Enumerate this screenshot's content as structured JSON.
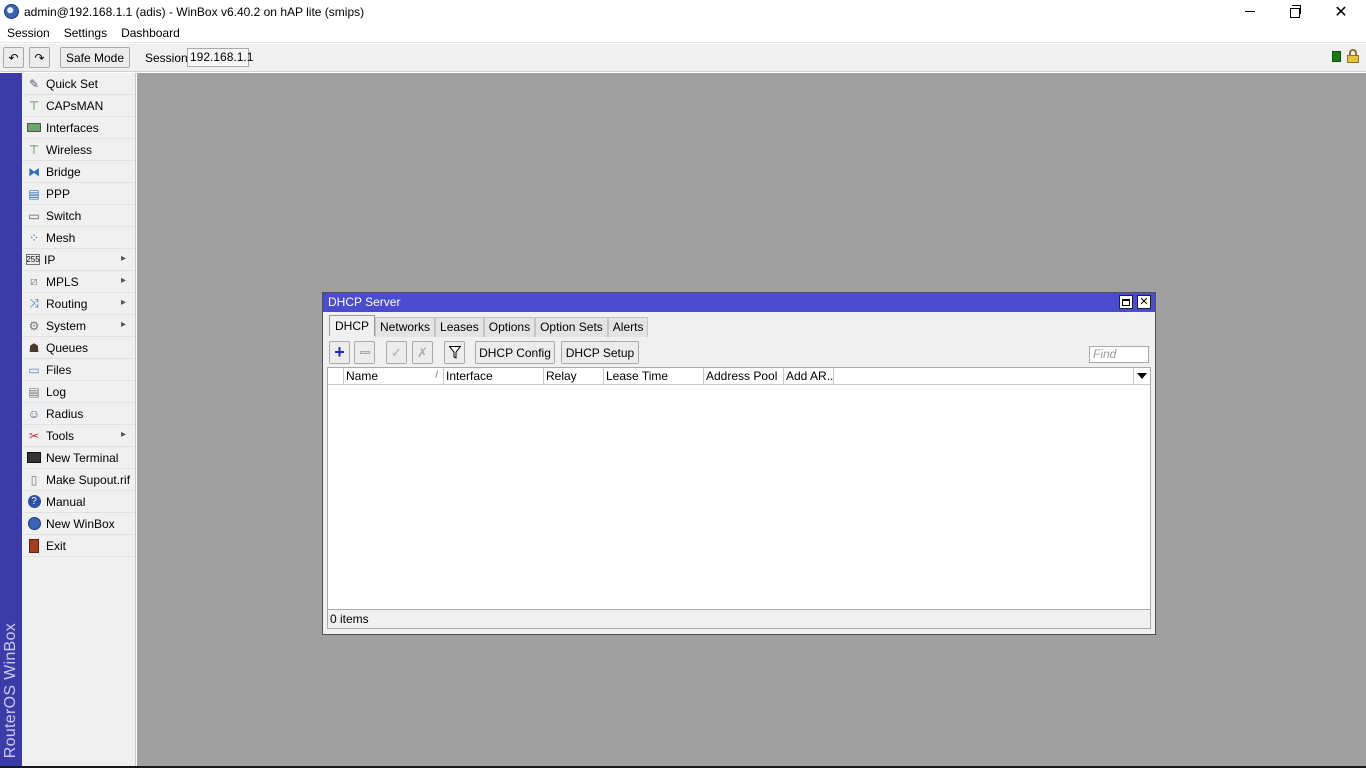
{
  "window": {
    "title": "admin@192.168.1.1 (adis) - WinBox v6.40.2 on hAP lite (smips)"
  },
  "menu": [
    "Session",
    "Settings",
    "Dashboard"
  ],
  "toolbar": {
    "safe_mode": "Safe Mode",
    "session_label": "Session:",
    "session_value": "192.168.1.1"
  },
  "brand": {
    "vertical_text": "RouterOS WinBox"
  },
  "sidebar": {
    "items": [
      {
        "label": "Quick Set",
        "icon": "quick-set-icon",
        "submenu": false
      },
      {
        "label": "CAPsMAN",
        "icon": "capsman-icon",
        "submenu": false
      },
      {
        "label": "Interfaces",
        "icon": "interfaces-icon",
        "submenu": false
      },
      {
        "label": "Wireless",
        "icon": "wireless-icon",
        "submenu": false
      },
      {
        "label": "Bridge",
        "icon": "bridge-icon",
        "submenu": false
      },
      {
        "label": "PPP",
        "icon": "ppp-icon",
        "submenu": false
      },
      {
        "label": "Switch",
        "icon": "switch-icon",
        "submenu": false
      },
      {
        "label": "Mesh",
        "icon": "mesh-icon",
        "submenu": false
      },
      {
        "label": "IP",
        "icon": "ip-icon",
        "submenu": true
      },
      {
        "label": "MPLS",
        "icon": "mpls-icon",
        "submenu": true
      },
      {
        "label": "Routing",
        "icon": "routing-icon",
        "submenu": true
      },
      {
        "label": "System",
        "icon": "system-icon",
        "submenu": true
      },
      {
        "label": "Queues",
        "icon": "queues-icon",
        "submenu": false
      },
      {
        "label": "Files",
        "icon": "files-icon",
        "submenu": false
      },
      {
        "label": "Log",
        "icon": "log-icon",
        "submenu": false
      },
      {
        "label": "Radius",
        "icon": "radius-icon",
        "submenu": false
      },
      {
        "label": "Tools",
        "icon": "tools-icon",
        "submenu": true
      },
      {
        "label": "New Terminal",
        "icon": "terminal-icon",
        "submenu": false
      },
      {
        "label": "Make Supout.rif",
        "icon": "supout-icon",
        "submenu": false
      },
      {
        "label": "Manual",
        "icon": "manual-icon",
        "submenu": false
      },
      {
        "label": "New WinBox",
        "icon": "winbox-icon",
        "submenu": false
      },
      {
        "label": "Exit",
        "icon": "exit-icon",
        "submenu": false
      }
    ]
  },
  "dialog": {
    "title": "DHCP Server",
    "tabs": [
      "DHCP",
      "Networks",
      "Leases",
      "Options",
      "Option Sets",
      "Alerts"
    ],
    "active_tab": "DHCP",
    "buttons": {
      "config": "DHCP Config",
      "setup": "DHCP Setup"
    },
    "find_placeholder": "Find",
    "columns": [
      "",
      "Name",
      "Interface",
      "Relay",
      "Lease Time",
      "Address Pool",
      "Add AR..."
    ],
    "rows": [],
    "status": "0 items"
  },
  "colors": {
    "dialog_title_bg": "#4b4ccd",
    "vertical_strip_bg": "#3c3ca8",
    "workspace_bg": "#a0a0a0"
  }
}
